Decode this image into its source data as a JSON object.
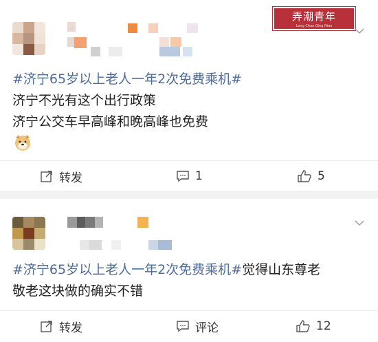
{
  "watermark": {
    "title": "弄潮青年",
    "subtitle": "Long Chao Qing Nian"
  },
  "posts": [
    {
      "content_topic": "#济宁65岁以上老人一年2次免费乘机#",
      "content_line1": "济宁不光有这个出行政策",
      "content_line2": "济宁公交车早高峰和晚高峰也免费",
      "emoji": "doge-emoji",
      "actions": {
        "repost_label": "转发",
        "comment_label": "1",
        "like_label": "5"
      }
    },
    {
      "content_topic": "#济宁65岁以上老人一年2次免费乘机#",
      "content_rest": "觉得山东尊老",
      "content_line2": "敬老这块做的确实不错",
      "actions": {
        "repost_label": "转发",
        "comment_label": "评论",
        "like_label": "12"
      }
    }
  ],
  "colors": {
    "topic": "#4e6c9a",
    "text": "#222222",
    "watermark": "#b8303a",
    "background": "#f2f2f2"
  },
  "icons": [
    "share-icon",
    "comment-icon",
    "like-icon",
    "chevron-down-icon"
  ]
}
